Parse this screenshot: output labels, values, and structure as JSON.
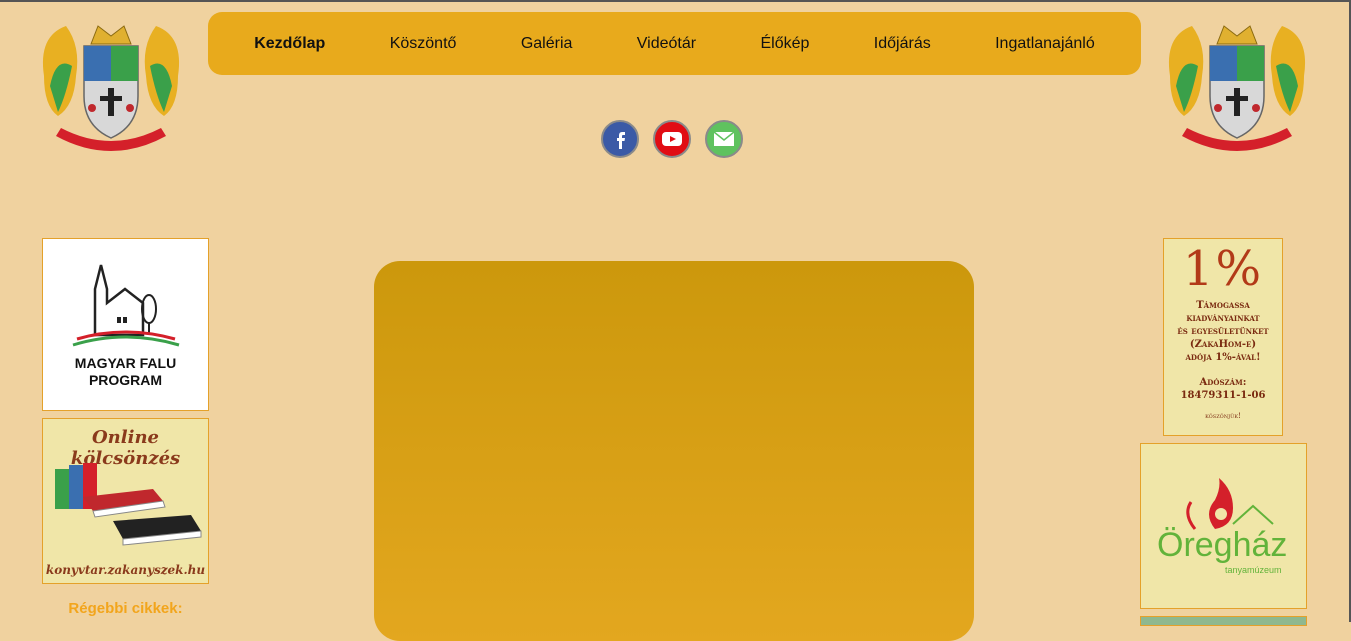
{
  "nav": {
    "items": [
      {
        "label": "Kezdőlap"
      },
      {
        "label": "Köszöntő"
      },
      {
        "label": "Galéria"
      },
      {
        "label": "Videótár"
      },
      {
        "label": "Élőkép"
      },
      {
        "label": "Időjárás"
      },
      {
        "label": "Ingatlanajánló"
      }
    ]
  },
  "social": [
    "facebook-icon",
    "youtube-icon",
    "email-icon"
  ],
  "left_sidebar": {
    "magyar_falu": {
      "line1": "MAGYAR FALU",
      "line2": "PROGRAM"
    },
    "online": {
      "title": "Online kölcsönzés",
      "url": "konyvtar.zakanyszek.hu"
    },
    "older_articles": "Régebbi cikkek:"
  },
  "right_sidebar": {
    "one_percent": {
      "big": "1%",
      "lines": [
        "Támogassa",
        "kiadványainkat",
        "és egyesületünket",
        "(ZakaHom-e)",
        "adója 1%-ával!"
      ],
      "tax_label": "Adószám:",
      "tax_number": "18479311-1-06",
      "thanks": "köszönjük!"
    },
    "oreghaz": {
      "name": "Öregház",
      "sub": "tanyamúzeum"
    }
  },
  "colors": {
    "background": "#f0d29f",
    "nav": "#e8aa1c",
    "panel": "#d39d10"
  }
}
